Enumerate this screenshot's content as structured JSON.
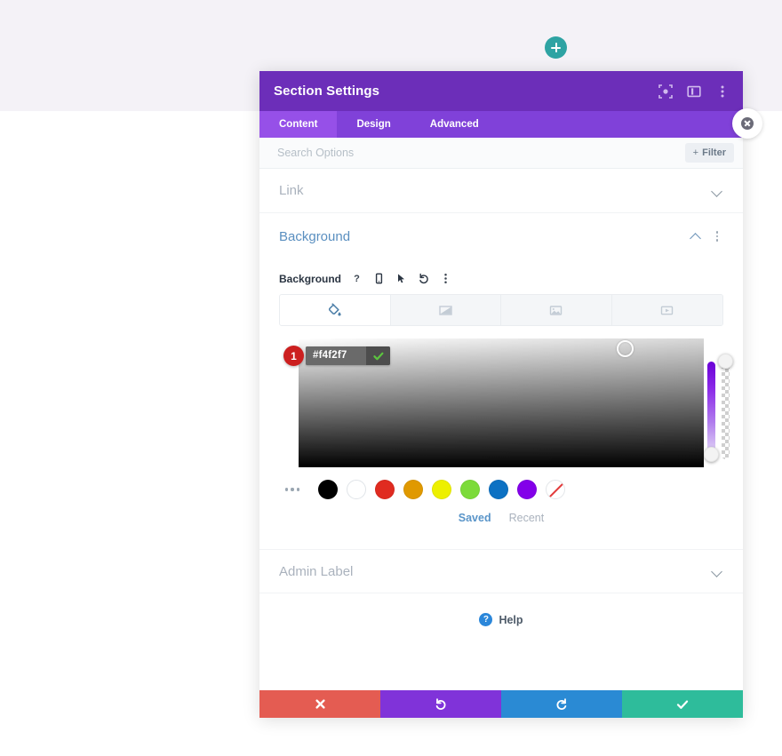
{
  "canvas": {
    "page_background_top": "#f4f2f7",
    "page_background_bottom": "#ffffff"
  },
  "add_section_button": {
    "icon": "plus-icon",
    "color": "#2ea3a3"
  },
  "close_button": {
    "icon": "close-icon"
  },
  "modal": {
    "header": {
      "title": "Section Settings",
      "background": "#6c2eb9",
      "icons": [
        {
          "name": "focus-icon",
          "label": "Focus"
        },
        {
          "name": "layout-panel-icon",
          "label": "Layout"
        },
        {
          "name": "more-vertical-icon",
          "label": "More"
        }
      ]
    },
    "tabs": [
      {
        "label": "Content",
        "active": true
      },
      {
        "label": "Design",
        "active": false
      },
      {
        "label": "Advanced",
        "active": false
      }
    ],
    "search": {
      "placeholder": "Search Options",
      "value": "",
      "filter_label": "Filter",
      "filter_plus": "+"
    },
    "sections": [
      {
        "title": "Link",
        "open": false
      },
      {
        "title": "Background",
        "open": true
      },
      {
        "title": "Admin Label",
        "open": false
      }
    ],
    "background_panel": {
      "field_label": "Background",
      "field_icons": [
        {
          "name": "help-question-icon",
          "glyph": "?"
        },
        {
          "name": "responsive-mobile-icon",
          "glyph": "mobile"
        },
        {
          "name": "hover-cursor-icon",
          "glyph": "cursor"
        },
        {
          "name": "reset-undo-icon",
          "glyph": "reset"
        },
        {
          "name": "more-vertical-icon",
          "glyph": "dots"
        }
      ],
      "type_tabs": [
        {
          "name": "background-color-tab",
          "icon": "paint-bucket-icon",
          "active": true
        },
        {
          "name": "background-gradient-tab",
          "icon": "gradient-icon",
          "active": false
        },
        {
          "name": "background-image-tab",
          "icon": "image-icon",
          "active": false
        },
        {
          "name": "background-video-tab",
          "icon": "video-icon",
          "active": false
        }
      ],
      "color_picker": {
        "badge": "1",
        "hex_value": "#f4f2f7",
        "confirm_icon": "checkmark-icon",
        "confirm_color": "#5cc43f",
        "hue_slider_label": "hue-slider",
        "alpha_slider_label": "alpha-slider"
      },
      "swatches": [
        {
          "name": "swatch-more",
          "color": "dots"
        },
        {
          "name": "swatch-black",
          "color": "#000000"
        },
        {
          "name": "swatch-white",
          "color": "#ffffff"
        },
        {
          "name": "swatch-red",
          "color": "#e02b20"
        },
        {
          "name": "swatch-orange",
          "color": "#e09900"
        },
        {
          "name": "swatch-yellow",
          "color": "#edf000"
        },
        {
          "name": "swatch-green",
          "color": "#7cdb39"
        },
        {
          "name": "swatch-blue",
          "color": "#0c71c3"
        },
        {
          "name": "swatch-purple",
          "color": "#8300e9"
        },
        {
          "name": "swatch-none",
          "color": "none"
        }
      ],
      "palette_tabs": [
        {
          "label": "Saved",
          "active": true
        },
        {
          "label": "Recent",
          "active": false
        }
      ]
    },
    "help": {
      "label": "Help",
      "icon_glyph": "?"
    },
    "footer": [
      {
        "name": "cancel-button",
        "icon": "x-icon",
        "color": "#e45c52"
      },
      {
        "name": "undo-button",
        "icon": "undo-icon",
        "color": "#8033d9"
      },
      {
        "name": "redo-button",
        "icon": "redo-icon",
        "color": "#2a8ad4"
      },
      {
        "name": "save-button",
        "icon": "checkmark-icon",
        "color": "#2ebc9b"
      }
    ]
  }
}
